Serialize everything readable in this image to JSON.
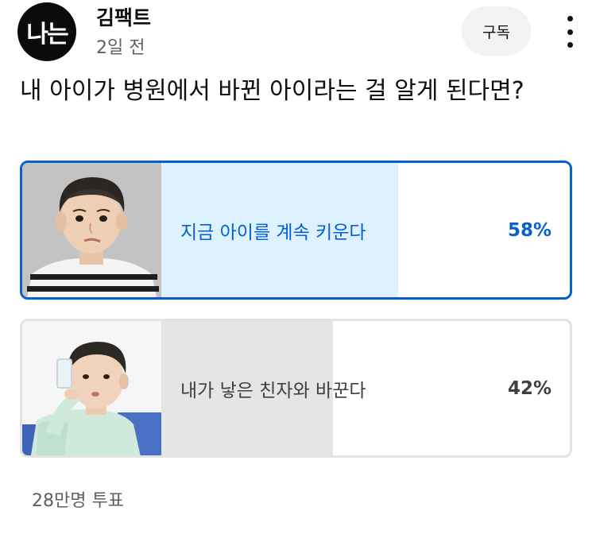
{
  "channel": {
    "avatar_text": "나는",
    "name": "김팩트",
    "time": "2일 전",
    "subscribe_label": "구독"
  },
  "post": {
    "question": "내 아이가 병원에서 바뀐 아이라는 걸 알게 된다면?"
  },
  "poll": {
    "options": [
      {
        "label": "지금 아이를 계속 키운다",
        "percent": "58%",
        "value": 0.58,
        "selected": true
      },
      {
        "label": "내가 낳은 친자와 바꾼다",
        "percent": "42%",
        "value": 0.42,
        "selected": false
      }
    ],
    "votes": "28만명 투표"
  },
  "colors": {
    "accent": "#065fd4",
    "selected_fill": "#def1ff",
    "unselected_fill": "#e5e5e5",
    "secondary_text": "#606060"
  },
  "icons": {
    "more": "more-vert-icon"
  }
}
